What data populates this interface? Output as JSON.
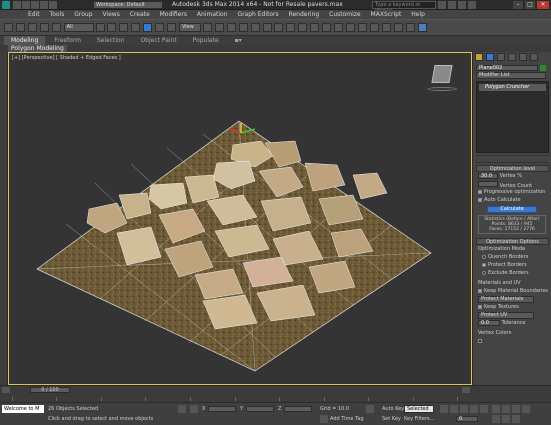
{
  "title": {
    "workspace_label": "Workspace: Default",
    "app_title": "Autodesk 3ds Max  2014 x64   - Not for Resale   pavers.max",
    "search_placeholder": "Type a keyword or phrase"
  },
  "menu": [
    "Edit",
    "Tools",
    "Group",
    "Views",
    "Create",
    "Modifiers",
    "Animation",
    "Graph Editors",
    "Rendering",
    "Customize",
    "MAXScript",
    "Help"
  ],
  "toolbar": {
    "selection_filter": "All",
    "view_dropdown": "View"
  },
  "ribbon": {
    "tabs": [
      "Modeling",
      "Freeform",
      "Selection",
      "Object Paint",
      "Populate"
    ],
    "sub_label": "Polygon Modeling"
  },
  "viewport": {
    "label": "[+] [Perspective] [ Shaded + Edged Faces ]"
  },
  "command_panel": {
    "object_name": "Plane002",
    "modifier_list": "Modifier List",
    "stack_item": "Polygon Cruncher",
    "optimization_level": {
      "header": "Optimization level",
      "percent_value": "30.0",
      "percent_label": "Vertex %",
      "count_value": "",
      "count_label": "Vertex Count",
      "progressive": "Progressive optimization",
      "auto_calc": "Auto Calculate",
      "calculate_button": "Calculate",
      "stats_line1": "Statistics (Before / After)",
      "stats_line2": "Points: 8633 / 945",
      "stats_line3": "Faces: 17152 / 2776"
    },
    "optimization_options": {
      "header": "Optimization Options",
      "mode_label": "Optimization Mode",
      "mode_options": [
        "Quench Borders",
        "Protect Borders",
        "Exclude Borders"
      ],
      "materials_label": "Materials and UV",
      "keep_material": "Keep Material Boundaries",
      "protect_materials": "Protect Materials",
      "keep_textures": "Keep Textures",
      "protect_uv": "Protect UV",
      "tolerance_value": "0.0",
      "tolerance_label": "Tolerance",
      "vertex_colors_label": "Vertex Colors"
    }
  },
  "timeline": {
    "frame_counter": "0 / 100",
    "tick_labels": [
      "0",
      "10",
      "20",
      "30",
      "40",
      "50",
      "60",
      "70",
      "80",
      "90",
      "100"
    ]
  },
  "status": {
    "welcome": "Welcome to M",
    "selected": "26 Objects Selected",
    "prompt": "Click and drag to select and move objects",
    "x_value": "",
    "grid_label": "Grid = 10.0",
    "autokey_label": "Auto Key",
    "selected_dropdown": "Selected",
    "setkey_label": "Set Key",
    "key_filters": "Key Filters...",
    "add_time_tag": "Add Time Tag",
    "frame_value": "0"
  },
  "colors": {
    "accent_blue": "#3a78d6",
    "viewport_border": "#d8c25a",
    "ground": "#6b5a3a"
  }
}
